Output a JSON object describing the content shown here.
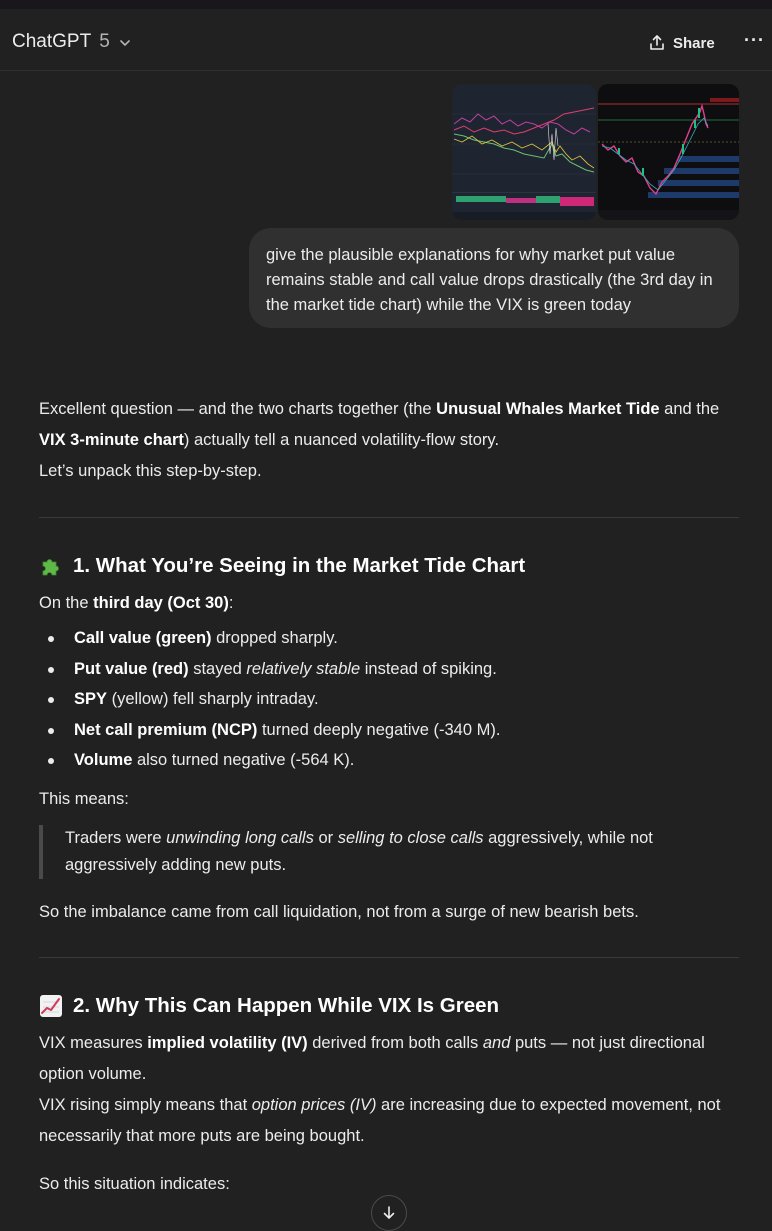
{
  "header": {
    "model_name": "ChatGPT",
    "model_version": "5",
    "share_label": "Share"
  },
  "user_message": {
    "text": "give the plausible explanations for why market put value remains stable and call value drops drastically (the 3rd day in the market tide chart) while the VIX is green today"
  },
  "response": {
    "intro": {
      "p1_a": "Excellent question — and the two charts together (the ",
      "p1_b": "Unusual Whales Market Tide",
      "p1_c": " and the ",
      "p1_d": "VIX 3-minute chart",
      "p1_e": ") actually tell a nuanced volatility-flow story.",
      "p2": "Let’s unpack this step-by-step."
    },
    "section1": {
      "heading": "1. What You’re Seeing in the Market Tide Chart",
      "lead_a": "On the ",
      "lead_b": "third day (Oct 30)",
      "lead_c": ":",
      "bullets": [
        {
          "bold": "Call value (green)",
          "rest": " dropped sharply."
        },
        {
          "bold": "Put value (red)",
          "mid": " stayed ",
          "italic": "relatively stable",
          "rest": " instead of spiking."
        },
        {
          "bold": "SPY",
          "rest": " (yellow) fell sharply intraday."
        },
        {
          "bold": "Net call premium (NCP)",
          "rest": " turned deeply negative (-340 M)."
        },
        {
          "bold": "Volume",
          "rest": " also turned negative (-564 K)."
        }
      ],
      "this_means": "This means:",
      "quote_a": "Traders were ",
      "quote_b": "unwinding long calls",
      "quote_c": " or ",
      "quote_d": "selling to close calls",
      "quote_e": " aggressively, while not aggressively adding new puts.",
      "conclusion": "So the imbalance came from call liquidation, not from a surge of new bearish bets."
    },
    "section2": {
      "heading": "2. Why This Can Happen While VIX Is Green",
      "p1_a": "VIX measures ",
      "p1_b": "implied volatility (IV)",
      "p1_c": " derived from both calls ",
      "p1_d": "and",
      "p1_e": " puts — not just directional option volume.",
      "p2_a": "VIX rising simply means that ",
      "p2_b": "option prices (IV)",
      "p2_c": " are increasing due to expected movement, not necessarily that more puts are being bought.",
      "p3": "So this situation indicates:"
    }
  },
  "icons": {
    "section1_icon": "puzzle-piece-icon",
    "section2_icon": "chart-increasing-icon",
    "share": "share-upload-icon",
    "more": "more-dots-icon",
    "scroll": "arrow-down-icon"
  },
  "colors": {
    "background": "#212121",
    "bubble": "#303030",
    "text": "#ececec"
  }
}
